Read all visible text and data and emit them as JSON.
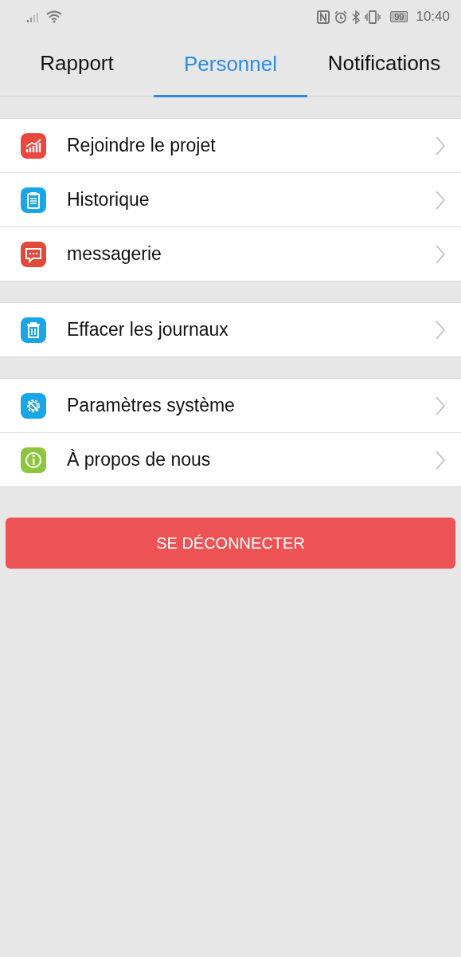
{
  "status_bar": {
    "battery": "99",
    "time": "10:40"
  },
  "tabs": [
    {
      "label": "Rapport",
      "selected": false
    },
    {
      "label": "Personnel",
      "selected": true
    },
    {
      "label": "Notifications",
      "selected": false
    }
  ],
  "groups": [
    {
      "items": [
        {
          "label": "Rejoindre le projet",
          "kind": "chart",
          "color": "#e9483f"
        },
        {
          "label": "Historique",
          "kind": "clipboard",
          "color": "#1aa6e4"
        },
        {
          "label": "messagerie",
          "kind": "chat",
          "color": "#e04a3c"
        }
      ]
    },
    {
      "items": [
        {
          "label": "Effacer les journaux",
          "kind": "trash",
          "color": "#1aa6e4"
        }
      ]
    },
    {
      "items": [
        {
          "label": "Paramètres système",
          "kind": "gear",
          "color": "#1aa6e4"
        },
        {
          "label": "À propos de nous",
          "kind": "info",
          "color": "#8cc63f"
        }
      ]
    }
  ],
  "logout_button": "SE DÉCONNECTER"
}
